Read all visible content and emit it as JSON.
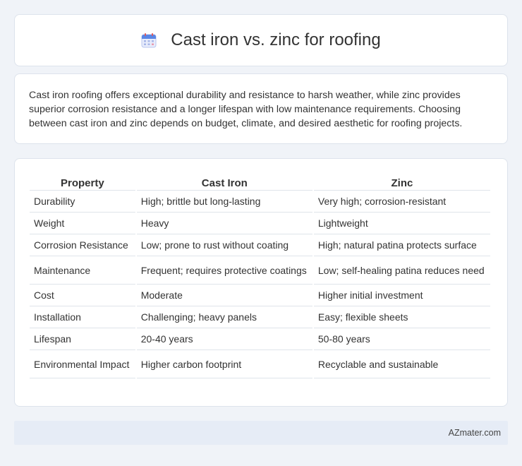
{
  "header": {
    "title": "Cast iron vs. zinc for roofing",
    "icon": "calendar-icon"
  },
  "intro": {
    "text": "Cast iron roofing offers exceptional durability and resistance to harsh weather, while zinc provides superior corrosion resistance and a longer lifespan with low maintenance requirements. Choosing between cast iron and zinc depends on budget, climate, and desired aesthetic for roofing projects."
  },
  "table": {
    "headers": [
      "Property",
      "Cast Iron",
      "Zinc"
    ],
    "rows": [
      [
        "Durability",
        "High; brittle but long-lasting",
        "Very high; corrosion-resistant"
      ],
      [
        "Weight",
        "Heavy",
        "Lightweight"
      ],
      [
        "Corrosion Resistance",
        "Low; prone to rust without coating",
        "High; natural patina protects surface"
      ],
      [
        "Maintenance",
        "Frequent; requires protective coatings",
        "Low; self-healing patina reduces need"
      ],
      [
        "Cost",
        "Moderate",
        "Higher initial investment"
      ],
      [
        "Installation",
        "Challenging; heavy panels",
        "Easy; flexible sheets"
      ],
      [
        "Lifespan",
        "20-40 years",
        "50-80 years"
      ],
      [
        "Environmental Impact",
        "Higher carbon footprint",
        "Recyclable and sustainable"
      ]
    ]
  },
  "footer": {
    "brand": "AZmater.com"
  },
  "colors": {
    "accent": "#4a7be0",
    "icon_red": "#e05a5a",
    "background": "#f0f3f8"
  }
}
